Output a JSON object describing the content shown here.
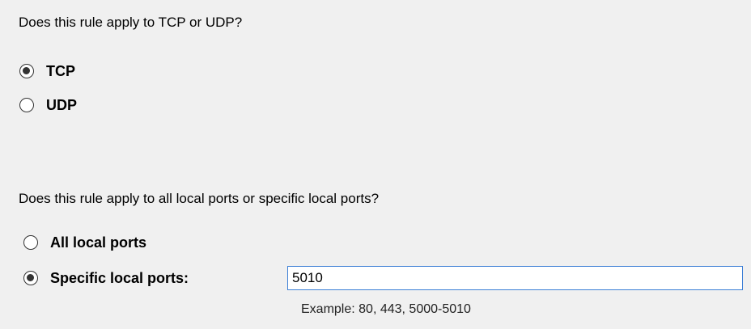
{
  "protocol": {
    "question": "Does this rule apply to TCP or UDP?",
    "options": [
      {
        "label": "TCP",
        "selected": true
      },
      {
        "label": "UDP",
        "selected": false
      }
    ]
  },
  "ports": {
    "question": "Does this rule apply to all local ports or specific local ports?",
    "options": [
      {
        "label": "All local ports",
        "selected": false
      },
      {
        "label": "Specific local ports:",
        "selected": true
      }
    ],
    "value": "5010",
    "example": "Example: 80, 443, 5000-5010"
  }
}
